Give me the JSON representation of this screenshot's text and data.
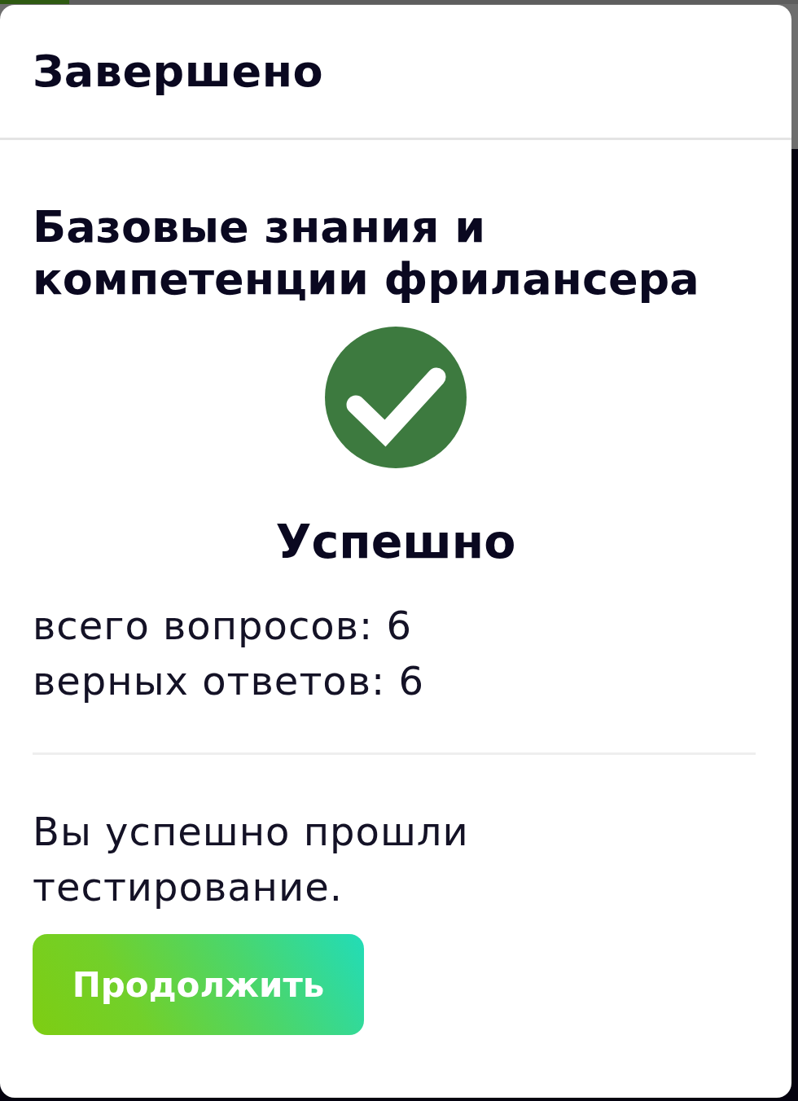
{
  "page_progress": {
    "level": 0.087
  },
  "dialog": {
    "title": "Завершено"
  },
  "test": {
    "title": "Базовые знания и компетенции фрилансера",
    "passed": true,
    "result": "Успешно",
    "stats": [
      "всего вопросов: 6",
      "верных ответов: 6"
    ],
    "message": "Вы успешно прошли тестирование.",
    "button": "Продолжить"
  }
}
